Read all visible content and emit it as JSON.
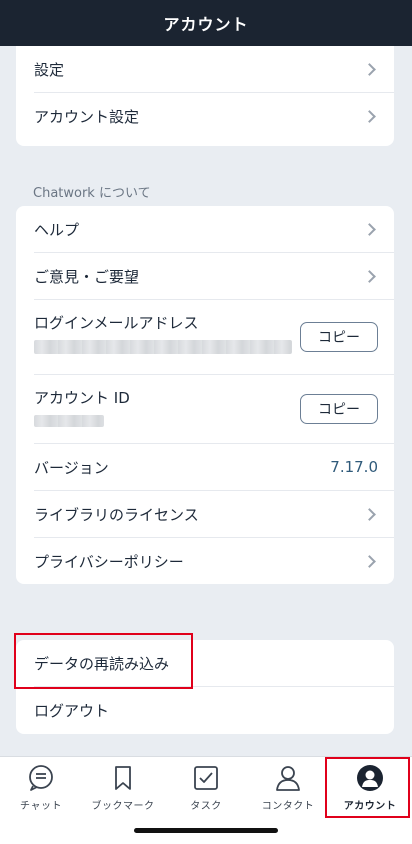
{
  "header": {
    "title": "アカウント"
  },
  "settings_card": {
    "items": [
      {
        "label": "設定"
      },
      {
        "label": "アカウント設定"
      }
    ]
  },
  "about_section": {
    "title": "Chatwork について",
    "help_label": "ヘルプ",
    "feedback_label": "ご意見・ご要望",
    "login_email_label": "ログインメールアドレス",
    "account_id_label": "アカウント ID",
    "copy_label": "コピー",
    "version_label": "バージョン",
    "version_value": "7.17.0",
    "licenses_label": "ライブラリのライセンス",
    "privacy_label": "プライバシーポリシー"
  },
  "actions_card": {
    "reload_label": "データの再読み込み",
    "logout_label": "ログアウト"
  },
  "tabbar": {
    "tabs": [
      {
        "label": "チャット",
        "icon": "chat-icon"
      },
      {
        "label": "ブックマーク",
        "icon": "bookmark-icon"
      },
      {
        "label": "タスク",
        "icon": "task-icon"
      },
      {
        "label": "コンタクト",
        "icon": "contact-icon"
      },
      {
        "label": "アカウント",
        "icon": "account-icon",
        "active": true
      }
    ]
  },
  "colors": {
    "header_bg": "#1b2431",
    "page_bg": "#e9edf2",
    "highlight": "#e0001b",
    "version_text": "#2f5a7a"
  }
}
